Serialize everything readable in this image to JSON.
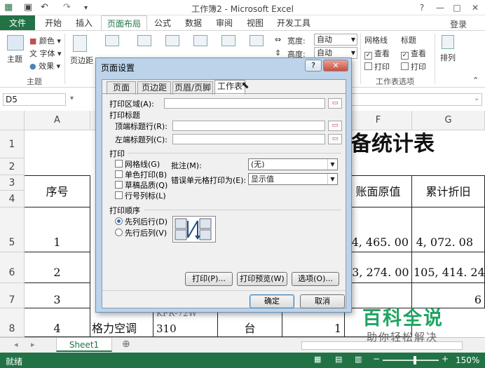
{
  "window": {
    "title": "工作簿2 - Microsoft Excel",
    "help": "?",
    "controls": [
      "—",
      "□",
      "✕"
    ]
  },
  "ribbon_tabs": [
    "文件",
    "开始",
    "插入",
    "页面布局",
    "公式",
    "数据",
    "审阅",
    "视图",
    "开发工具"
  ],
  "login": "登录",
  "ribbon": {
    "theme_label": "主题",
    "colors": "颜色",
    "fonts": "字体",
    "effects": "效果",
    "margins": "页边距",
    "width_label": "宽度:",
    "width_value": "自动",
    "height_label": "高度:",
    "height_value": "自动",
    "gridlines_group": "网格线",
    "headings_group": "标题",
    "view": "查看",
    "print": "打印",
    "sheet_options_group": "工作表选项",
    "arrange": "排列",
    "theme_group": "主题"
  },
  "formula_bar": {
    "name_box": "D5"
  },
  "grid": {
    "columns": [
      "A",
      "F",
      "G"
    ],
    "rows": [
      "1",
      "2",
      "3",
      "4",
      "5",
      "6",
      "7",
      "8"
    ],
    "title_fragment": "备统计表",
    "header_no": "序号",
    "header_f": "账面原值",
    "header_g": "累计折旧",
    "r5_a": "1",
    "r5_f": "4, 465. 00",
    "r5_g": "4, 072. 08",
    "r6_a": "2",
    "r6_f": "13, 274. 00",
    "r6_g": "105, 414. 24",
    "r7_a": "3",
    "r8_a": "4",
    "r8_b": "格力空调",
    "r8_c": "310",
    "r8_c_top": "KFR-72W",
    "r8_d": "台",
    "r8_e": "1",
    "frag_6": "6"
  },
  "sheet_tab": "Sheet1",
  "status": {
    "ready": "就绪",
    "zoom": "150%"
  },
  "dialog": {
    "title": "页面设置",
    "tabs": [
      "页面",
      "页边距",
      "页眉/页脚",
      "工作表"
    ],
    "print_area": "打印区域(A):",
    "print_titles": "打印标题",
    "top_rows": "顶端标题行(R):",
    "left_cols": "左端标题列(C):",
    "print_section": "打印",
    "gridlines": "网格线(G)",
    "mono": "单色打印(B)",
    "draft": "草稿品质(Q)",
    "rowcol_headings": "行号列标(L)",
    "comments_label": "批注(M):",
    "comments_value": "(无)",
    "errors_label": "错误单元格打印为(E):",
    "errors_value": "显示值",
    "order_section": "打印顺序",
    "down_then_over": "先列后行(D)",
    "over_then_down": "先行后列(V)",
    "print_btn": "打印(P)...",
    "preview_btn": "打印预览(W)",
    "options_btn": "选项(O)...",
    "ok_btn": "确定",
    "cancel_btn": "取消"
  },
  "watermark": {
    "brand": "百科全说",
    "tagline": "助你轻松解决"
  },
  "colors": {
    "excel_green": "#217346",
    "dialog_frame": "#bcd3ea",
    "watermark_green": "#1fa463"
  }
}
